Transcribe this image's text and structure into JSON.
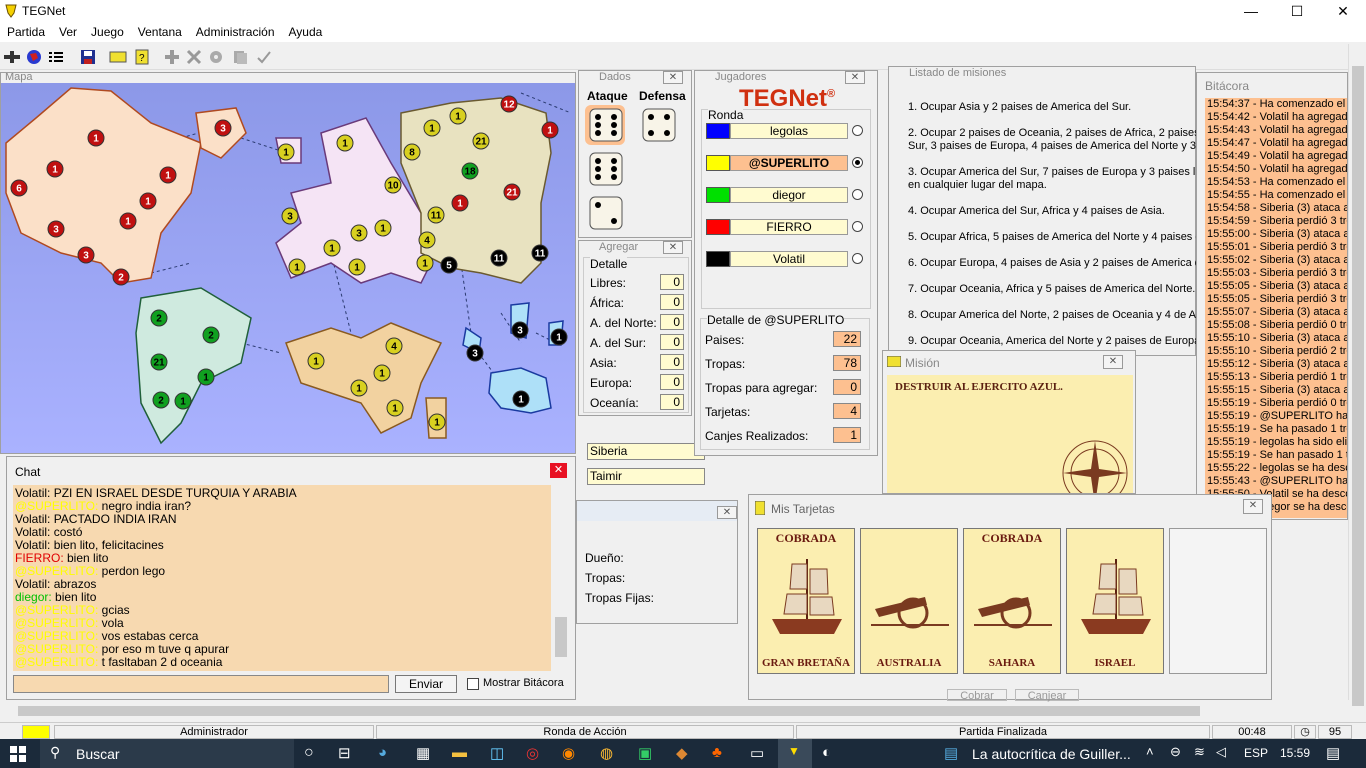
{
  "window": {
    "title": "TEGNet",
    "min": "—",
    "max": "☐",
    "close": "✕"
  },
  "menu": [
    "Partida",
    "Ver",
    "Juego",
    "Ventana",
    "Administración",
    "Ayuda"
  ],
  "map_panel": {
    "title": "Mapa"
  },
  "dice_panel": {
    "title": "Dados",
    "attack_label": "Ataque",
    "defense_label": "Defensa",
    "attack_dice": [
      6,
      6,
      2
    ],
    "defense_dice": [
      4
    ]
  },
  "add_panel": {
    "title": "Agregar",
    "group": "Detalle",
    "rows": [
      {
        "label": "Libres:",
        "value": "0"
      },
      {
        "label": "África:",
        "value": "0"
      },
      {
        "label": "A. del Norte:",
        "value": "0"
      },
      {
        "label": "A. del Sur:",
        "value": "0"
      },
      {
        "label": "Asia:",
        "value": "0"
      },
      {
        "label": "Europa:",
        "value": "0"
      },
      {
        "label": "Oceanía:",
        "value": "0"
      }
    ],
    "country1": "Siberia",
    "country2": "Taimir"
  },
  "country_panel": {
    "owner_label": "Dueño:",
    "troops_label": "Tropas:",
    "fixed_label": "Tropas Fijas:"
  },
  "players_panel": {
    "title": "Jugadores",
    "logo": "TEGNet",
    "logo_reg": "®",
    "group": "Ronda",
    "players": [
      {
        "name": "legolas",
        "color": "#0000ff",
        "selected": false,
        "bold": false
      },
      {
        "name": "@SUPERLITO",
        "color": "#ffff00",
        "selected": true,
        "bold": true
      },
      {
        "name": "diegor",
        "color": "#00e000",
        "selected": false,
        "bold": false
      },
      {
        "name": "FIERRO",
        "color": "#ff0000",
        "selected": false,
        "bold": false
      },
      {
        "name": "Volatil",
        "color": "#000000",
        "selected": false,
        "bold": false
      }
    ],
    "detail_title": "Detalle de @SUPERLITO",
    "detail": [
      {
        "label": "Paises:",
        "value": "22"
      },
      {
        "label": "Tropas:",
        "value": "78"
      },
      {
        "label": "Tropas para agregar:",
        "value": "0"
      },
      {
        "label": "Tarjetas:",
        "value": "4"
      },
      {
        "label": "Canjes Realizados:",
        "value": "1"
      }
    ]
  },
  "missions_panel": {
    "title": "Listado de misiones",
    "items": [
      "1. Ocupar Asia y 2 paises de America del Sur.",
      "2. Ocupar 2 paises de Oceania, 2 paises de Africa, 2 paises",
      "Sur, 3 paises de Europa, 4 paises de America del Norte y 3 d",
      "3. Ocupar America del Sur, 7 paises de Europa y 3 paises lim",
      "en cualquier lugar del mapa.",
      "4. Ocupar America del Sur, Africa y 4 paises de Asia.",
      "5. Ocupar Africa, 5 paises de America del Norte y 4 paises de",
      "6. Ocupar Europa, 4 paises de Asia y 2 paises de America de",
      "7. Ocupar Oceania, Africa y 5 paises de America del Norte.",
      "8. Ocupar America del Norte, 2 paises de Oceania y 4 de Asi",
      "9. Ocupar Oceania, America del Norte y 2 paises de Europa."
    ]
  },
  "mission_panel": {
    "title": "Misión",
    "text": "DESTRUIR AL EJERCITO AZUL."
  },
  "log_panel": {
    "title": "Bitácora",
    "lines": [
      "15:54:37 - Ha comenzado el t",
      "15:54:42 - Volatil ha agregad",
      "15:54:43 - Volatil ha agregad",
      "15:54:47 - Volatil ha agregad",
      "15:54:49 - Volatil ha agregad",
      "15:54:50 - Volatil ha agregad",
      "15:54:53 - Ha comenzado el t",
      "15:54:55 - Ha comenzado el t",
      "15:54:58 - Siberia (3) ataca a",
      "15:54:59 - Siberia perdió 3 tro",
      "15:55:00 - Siberia (3) ataca a",
      "15:55:01 - Siberia perdió 3 tro",
      "15:55:02 - Siberia (3) ataca a",
      "15:55:03 - Siberia perdió 3 tro",
      "15:55:05 - Siberia (3) ataca a",
      "15:55:05 - Siberia perdió 3 tro",
      "15:55:07 - Siberia (3) ataca a",
      "15:55:08 - Siberia perdió 0 tro",
      "15:55:10 - Siberia (3) ataca a",
      "15:55:10 - Siberia perdió 2 tro",
      "15:55:12 - Siberia (3) ataca a",
      "15:55:13 - Siberia perdió 1 tro",
      "15:55:15 - Siberia (3) ataca a",
      "15:55:19 - Siberia perdió 0 tro",
      "15:55:19 - @SUPERLITO ha",
      "15:55:19 - Se ha pasado 1 tro",
      "15:55:19 - legolas ha sido elim",
      "15:55:19 - Se han pasado 1 tr",
      "15:55:22 - legolas se ha desc",
      "15:55:43 - @SUPERLITO ha",
      "15:55:50 - Volatil se ha desco",
      "15:55:55 - diegor se ha desco"
    ]
  },
  "chat": {
    "title": "Chat",
    "lines": [
      {
        "nick": "Volatil:",
        "msg": " PZI EN ISRAEL DESDE TURQUIA Y ARABIA",
        "c": ""
      },
      {
        "nick": "@SUPERLITO:",
        "msg": " negro india iran?",
        "c": "ylw"
      },
      {
        "nick": "Volatil:",
        "msg": " PACTADO INDIA IRAN",
        "c": ""
      },
      {
        "nick": "Volatil:",
        "msg": " costó",
        "c": ""
      },
      {
        "nick": "Volatil:",
        "msg": " bien lito, felicitacines",
        "c": ""
      },
      {
        "nick": "FIERRO:",
        "msg": " bien lito",
        "c": "red"
      },
      {
        "nick": "@SUPERLITO:",
        "msg": " perdon lego",
        "c": "ylw"
      },
      {
        "nick": "Volatil:",
        "msg": " abrazos",
        "c": ""
      },
      {
        "nick": "diegor:",
        "msg": " bien lito",
        "c": "grn"
      },
      {
        "nick": "@SUPERLITO:",
        "msg": " gcias",
        "c": "ylw"
      },
      {
        "nick": "@SUPERLITO:",
        "msg": " vola",
        "c": "ylw"
      },
      {
        "nick": "@SUPERLITO:",
        "msg": " vos estabas cerca",
        "c": "ylw"
      },
      {
        "nick": "@SUPERLITO:",
        "msg": " por eso m tuve q apurar",
        "c": "ylw"
      },
      {
        "nick": "@SUPERLITO:",
        "msg": " t fasltaban 2 d oceania",
        "c": "ylw"
      }
    ],
    "input_value": "",
    "send_label": "Enviar",
    "show_log_label": "Mostrar Bitácora"
  },
  "cards_panel": {
    "title": "Mis Tarjetas",
    "cards": [
      {
        "status": "COBRADA",
        "country": "GRAN BRETAÑA",
        "kind": "ship-icon"
      },
      {
        "status": "",
        "country": "AUSTRALIA",
        "kind": "cannon-icon"
      },
      {
        "status": "COBRADA",
        "country": "SAHARA",
        "kind": "cannon-icon"
      },
      {
        "status": "",
        "country": "ISRAEL",
        "kind": "ship-icon"
      }
    ],
    "collect_label": "Cobrar",
    "exchange_label": "Canjear"
  },
  "statusbar": {
    "role": "Administrador",
    "round": "Ronda de Acción",
    "state": "Partida Finalizada",
    "time": "00:48",
    "count": "95",
    "color": "#ffff00"
  },
  "taskbar": {
    "search": "Buscar",
    "app_label": "La autocrítica de Guiller...",
    "lang": "ESP",
    "clock": "15:59"
  },
  "map_armies": [
    {
      "n": "1",
      "c": "red"
    },
    {
      "n": "3",
      "c": "red"
    },
    {
      "n": "6",
      "c": "red"
    },
    {
      "n": "1",
      "c": "red"
    },
    {
      "n": "1",
      "c": "red"
    },
    {
      "n": "1",
      "c": "red"
    },
    {
      "n": "1",
      "c": "red"
    },
    {
      "n": "3",
      "c": "red"
    },
    {
      "n": "3",
      "c": "red"
    },
    {
      "n": "2",
      "c": "red"
    },
    {
      "n": "12",
      "c": "red"
    },
    {
      "n": "1",
      "c": "red"
    },
    {
      "n": "21",
      "c": "red"
    },
    {
      "n": "1",
      "c": "red"
    },
    {
      "n": "1",
      "c": "ylw"
    },
    {
      "n": "1",
      "c": "ylw"
    },
    {
      "n": "3",
      "c": "ylw"
    },
    {
      "n": "1",
      "c": "ylw"
    },
    {
      "n": "1",
      "c": "ylw"
    },
    {
      "n": "1",
      "c": "ylw"
    },
    {
      "n": "3",
      "c": "ylw"
    },
    {
      "n": "1",
      "c": "ylw"
    },
    {
      "n": "10",
      "c": "ylw"
    },
    {
      "n": "8",
      "c": "ylw"
    },
    {
      "n": "1",
      "c": "ylw"
    },
    {
      "n": "1",
      "c": "ylw"
    },
    {
      "n": "21",
      "c": "ylw"
    },
    {
      "n": "11",
      "c": "ylw"
    },
    {
      "n": "4",
      "c": "ylw"
    },
    {
      "n": "1",
      "c": "ylw"
    },
    {
      "n": "1",
      "c": "ylw"
    },
    {
      "n": "4",
      "c": "ylw"
    },
    {
      "n": "1",
      "c": "ylw"
    },
    {
      "n": "1",
      "c": "ylw"
    },
    {
      "n": "1",
      "c": "ylw"
    },
    {
      "n": "1",
      "c": "ylw"
    },
    {
      "n": "18",
      "c": "grn"
    },
    {
      "n": "2",
      "c": "grn"
    },
    {
      "n": "2",
      "c": "grn"
    },
    {
      "n": "21",
      "c": "grn"
    },
    {
      "n": "1",
      "c": "grn"
    },
    {
      "n": "2",
      "c": "grn"
    },
    {
      "n": "1",
      "c": "grn"
    },
    {
      "n": "5",
      "c": "blk"
    },
    {
      "n": "11",
      "c": "blk"
    },
    {
      "n": "11",
      "c": "blk"
    },
    {
      "n": "3",
      "c": "blk"
    },
    {
      "n": "3",
      "c": "blk"
    },
    {
      "n": "1",
      "c": "blk"
    },
    {
      "n": "1",
      "c": "blk"
    }
  ]
}
